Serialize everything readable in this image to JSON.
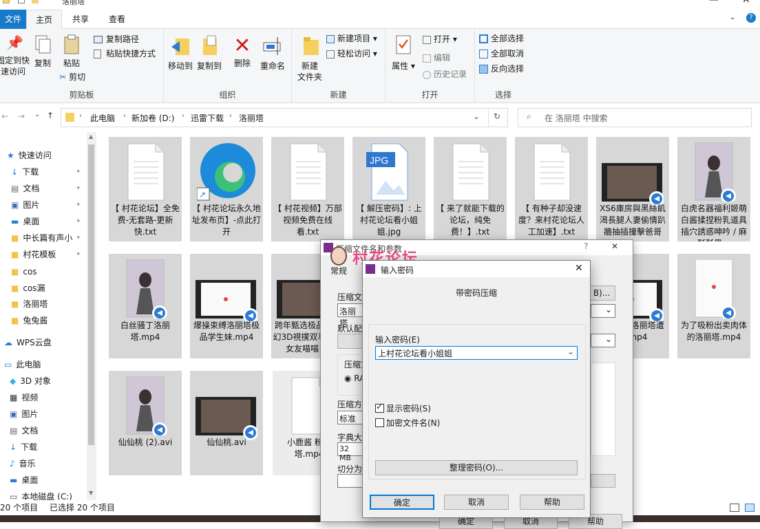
{
  "window": {
    "title": "洛丽塔"
  },
  "tabs": [
    "文件",
    "主页",
    "共享",
    "查看"
  ],
  "ribbon": {
    "pin_label": "固定到快\n速访问",
    "copy": "复制",
    "paste": "粘贴",
    "copy_path": "复制路径",
    "paste_shortcut": "粘贴快捷方式",
    "cut": "剪切",
    "clipboard_group": "剪贴板",
    "move_to": "移动到",
    "copy_to": "复制到",
    "delete": "删除",
    "rename": "重命名",
    "organize_group": "组织",
    "new_folder": "新建\n文件夹",
    "new_item": "新建项目",
    "easy_access": "轻松访问",
    "new_group": "新建",
    "properties": "属性",
    "open": "打开",
    "edit": "编辑",
    "history": "历史记录",
    "open_group": "打开",
    "select_all": "全部选择",
    "select_none": "全部取消",
    "invert": "反向选择",
    "select_group": "选择"
  },
  "breadcrumb": [
    "此电脑",
    "新加卷 (D:)",
    "迅雷下载",
    "洛丽塔"
  ],
  "search": {
    "placeholder": "在 洛丽塔 中搜索"
  },
  "nav": [
    {
      "label": "快速访问",
      "icon": "star-icon"
    },
    {
      "label": "下载",
      "icon": "download-icon"
    },
    {
      "label": "文档",
      "icon": "document-icon"
    },
    {
      "label": "图片",
      "icon": "picture-icon"
    },
    {
      "label": "桌面",
      "icon": "desktop-icon"
    },
    {
      "label": "中长篇有声小",
      "icon": "folder-icon"
    },
    {
      "label": "村花模板",
      "icon": "folder-icon"
    },
    {
      "label": "cos",
      "icon": "folder-icon"
    },
    {
      "label": "cos漏",
      "icon": "folder-icon"
    },
    {
      "label": "洛丽塔",
      "icon": "folder-icon"
    },
    {
      "label": "兔兔酱",
      "icon": "folder-icon"
    },
    {
      "label": "WPS云盘",
      "icon": "cloud-icon"
    },
    {
      "label": "此电脑",
      "icon": "computer-icon"
    },
    {
      "label": "3D 对象",
      "icon": "cube-icon"
    },
    {
      "label": "视频",
      "icon": "video-icon"
    },
    {
      "label": "图片",
      "icon": "picture-icon"
    },
    {
      "label": "文档",
      "icon": "document-icon"
    },
    {
      "label": "下载",
      "icon": "download-icon"
    },
    {
      "label": "音乐",
      "icon": "music-icon"
    },
    {
      "label": "桌面",
      "icon": "desktop-icon"
    },
    {
      "label": "本地磁盘 (C:)",
      "icon": "drive-icon"
    }
  ],
  "files": [
    {
      "name": "【 村花论坛】全免费-无套路-更新快.txt",
      "kind": "txt"
    },
    {
      "name": "【 村花论坛永久地址发布页】-点此打开",
      "kind": "edge"
    },
    {
      "name": "【 村花视频】万部视频免费在线看.txt",
      "kind": "txt"
    },
    {
      "name": "【 解压密码】: 上村花论坛看小姐姐.jpg",
      "kind": "jpg"
    },
    {
      "name": "【 来了就能下载的论坛，纯免费！】.txt",
      "kind": "txt"
    },
    {
      "name": "【 有种子却没速度？来村花论坛人工加速】.txt",
      "kind": "txt"
    },
    {
      "name": "XS6庫房與黑絲飢渴長腿人妻偷情趴牆抽插撞擊爸哥哥...",
      "kind": "video"
    },
    {
      "name": "白虎名器福利姬萌白酱揉捏粉乳道具插穴誘惑呻吟 / 麻酥酥黑...",
      "kind": "photo"
    },
    {
      "name": "白丝骚丁洛丽塔.mp4",
      "kind": "photo"
    },
    {
      "name": "爆操束缚洛丽塔极品学生妹.mp4",
      "kind": "videowhite"
    },
    {
      "name": "跨年甄选极品莉超幻3D視撲双马尾洛女友喵喵 抓",
      "kind": "video"
    },
    {
      "name": "g『粉色洛丽塔遭星.mp4",
      "kind": "videowhite"
    },
    {
      "name": "为了吸粉出卖肉体的洛丽塔.mp4",
      "kind": "photowhite"
    },
    {
      "name": "仙仙桃 (2).avi",
      "kind": "photo"
    },
    {
      "name": "仙仙桃.avi",
      "kind": "video"
    },
    {
      "name": "小鹿酱 粉色塔.mp4",
      "kind": "blank"
    }
  ],
  "status": {
    "count": "20 个项目",
    "selected": "已选择 20 个项目"
  },
  "bg_dialog": {
    "title": "压缩文件名和参数",
    "tab_general": "常规",
    "archive_label": "压缩文",
    "archive_value": "洛丽塔",
    "browse": "浏览(B)...",
    "default_label": "默认配",
    "format_label": "压缩文",
    "format_rar": "RA",
    "method_label": "压缩方",
    "method_value": "标准",
    "dict_label": "字典大",
    "dict_value": "32 MB",
    "split_label": "切分为",
    "ok": "确定",
    "cancel": "取消",
    "help": "帮助"
  },
  "pw_dialog": {
    "title": "输入密码",
    "heading": "带密码压缩",
    "input_label": "输入密码(E)",
    "password": "上村花论坛看小姐姐",
    "show_pw": "显示密码(S)",
    "encrypt_names": "加密文件名(N)",
    "organize": "整理密码(O)...",
    "ok": "确定",
    "cancel": "取消",
    "help": "帮助"
  },
  "watermark": "村花论坛"
}
